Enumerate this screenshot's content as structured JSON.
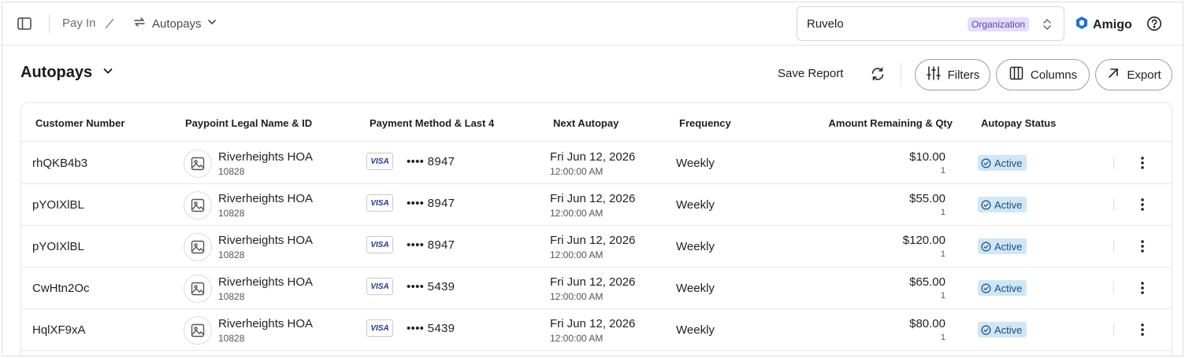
{
  "breadcrumb": {
    "items": [
      "Pay In",
      "Autopays"
    ]
  },
  "org_selector": {
    "name": "Ruvelo",
    "badge": "Organization"
  },
  "brand": {
    "name": "Amigo",
    "color": "#1f6fd6"
  },
  "page": {
    "title": "Autopays"
  },
  "toolbar": {
    "save_report": "Save Report",
    "filters": "Filters",
    "columns": "Columns",
    "export": "Export"
  },
  "table": {
    "columns": [
      "Customer Number",
      "Paypoint Legal Name & ID",
      "Payment Method & Last 4",
      "Next Autopay",
      "Frequency",
      "Amount Remaining & Qty",
      "Autopay Status"
    ],
    "rows": [
      {
        "customer": "rhQKB4b3",
        "paypoint_name": "Riverheights HOA",
        "paypoint_id": "10828",
        "card_brand": "VISA",
        "last4": "•••• 8947",
        "next_date": "Fri Jun 12, 2026",
        "next_time": "12:00:00 AM",
        "frequency": "Weekly",
        "amount": "$10.00",
        "qty": "1",
        "status": "Active"
      },
      {
        "customer": "pYOIXlBL",
        "paypoint_name": "Riverheights HOA",
        "paypoint_id": "10828",
        "card_brand": "VISA",
        "last4": "•••• 8947",
        "next_date": "Fri Jun 12, 2026",
        "next_time": "12:00:00 AM",
        "frequency": "Weekly",
        "amount": "$55.00",
        "qty": "1",
        "status": "Active"
      },
      {
        "customer": "pYOIXlBL",
        "paypoint_name": "Riverheights HOA",
        "paypoint_id": "10828",
        "card_brand": "VISA",
        "last4": "•••• 8947",
        "next_date": "Fri Jun 12, 2026",
        "next_time": "12:00:00 AM",
        "frequency": "Weekly",
        "amount": "$120.00",
        "qty": "1",
        "status": "Active"
      },
      {
        "customer": "CwHtn2Oc",
        "paypoint_name": "Riverheights HOA",
        "paypoint_id": "10828",
        "card_brand": "VISA",
        "last4": "•••• 5439",
        "next_date": "Fri Jun 12, 2026",
        "next_time": "12:00:00 AM",
        "frequency": "Weekly",
        "amount": "$65.00",
        "qty": "1",
        "status": "Active"
      },
      {
        "customer": "HqlXF9xA",
        "paypoint_name": "Riverheights HOA",
        "paypoint_id": "10828",
        "card_brand": "VISA",
        "last4": "•••• 5439",
        "next_date": "Fri Jun 12, 2026",
        "next_time": "12:00:00 AM",
        "frequency": "Weekly",
        "amount": "$80.00",
        "qty": "1",
        "status": "Active"
      }
    ]
  },
  "colors": {
    "status_bg": "#cfe6f7",
    "status_text": "#1f4e79",
    "badge_bg": "#e6dcfb",
    "badge_text": "#5b3fb5"
  },
  "icons": {
    "sidebar_toggle": "sidebar-toggle-icon",
    "repeat": "repeat-icon",
    "chevron": "chevron-down-icon",
    "sort": "sort-arrows-icon",
    "help": "help-circle-icon",
    "refresh": "refresh-icon",
    "filters": "sliders-icon",
    "columns": "columns-icon",
    "export": "arrow-up-right-icon",
    "image": "image-placeholder-icon",
    "check": "check-circle-icon",
    "kebab": "more-vertical-icon"
  }
}
